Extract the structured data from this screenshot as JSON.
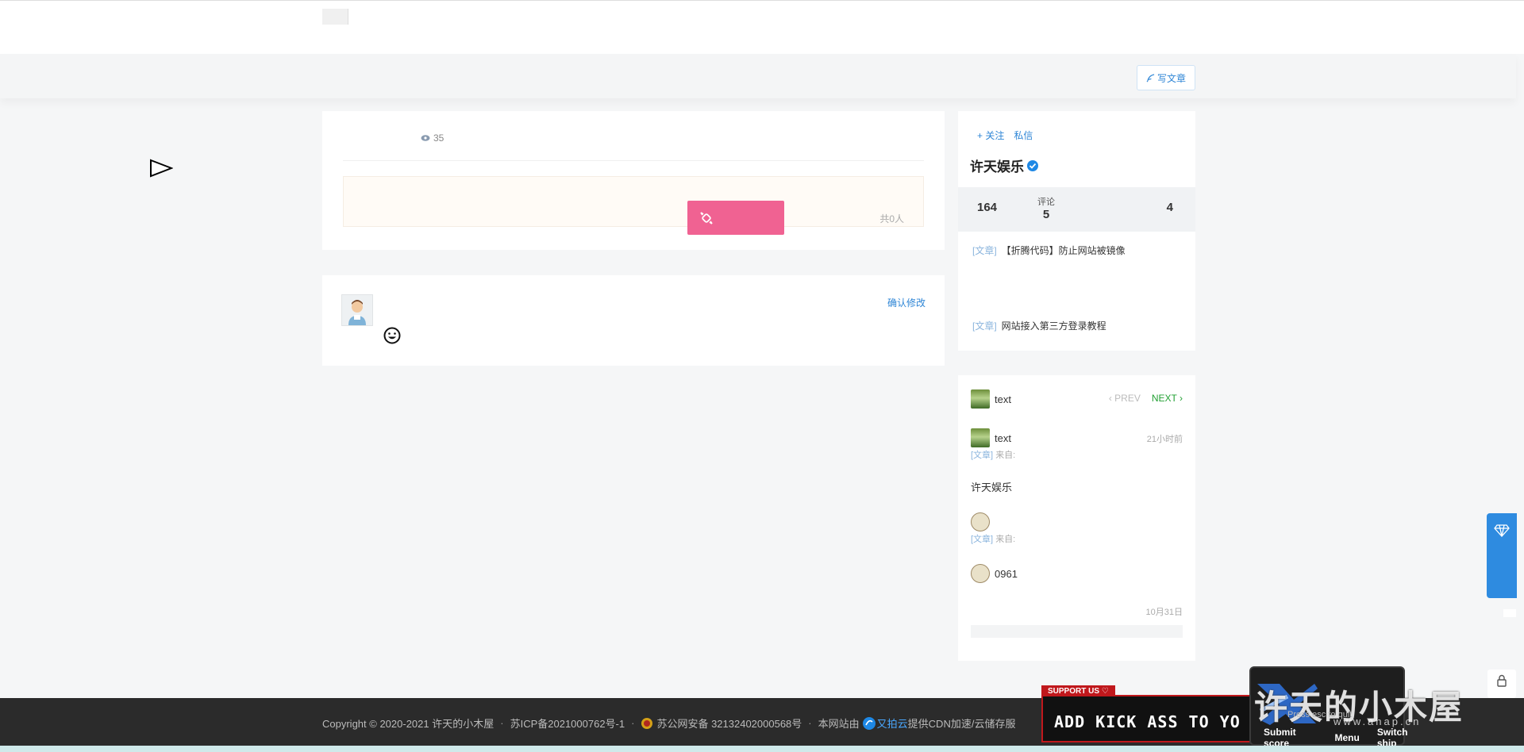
{
  "header": {
    "write_label": "写文章"
  },
  "post": {
    "views": "35",
    "reward_count": "共0人"
  },
  "comment": {
    "confirm_label": "确认修改"
  },
  "profile": {
    "follow_label": "+ 关注",
    "message_label": "私信",
    "name": "许天娱乐",
    "stat_a": "164",
    "stat_b_label": "评论",
    "stat_b_value": "5",
    "stat_c": "4",
    "articles": [
      {
        "tag": "[文章]",
        "title": "【折腾代码】防止网站被镜像"
      },
      {
        "tag": "[文章]",
        "title": "网站接入第三方登录教程"
      }
    ]
  },
  "feed": {
    "prev_label": "PREV",
    "next_label": "NEXT",
    "row1_user": "text",
    "row2_user": "text",
    "row2_time": "21小时前",
    "row2_meta_tag": "[文章]",
    "row2_meta_text": "来自:",
    "row3_text": "许天娱乐",
    "row4_meta_tag": "[文章]",
    "row4_meta_text": "来自:",
    "row5_user": "0961",
    "row5_time": "10月31日"
  },
  "footer": {
    "copyright": "Copyright © 2020-2021 许天的小木屋",
    "icp": "苏ICP备2021000762号-1",
    "police": "苏公网安备 32132402000568号",
    "cdn_prefix": "本网站由",
    "cdn_brand": "又拍云",
    "cdn_suffix": "提供CDN加速/云储存服"
  },
  "game": {
    "support_label": "SUPPORT US ♡",
    "title": "ADD KICK ASS TO YO",
    "esc_hint": "Press esc to quit",
    "menu": [
      "Submit score",
      "Menu",
      "Switch ship"
    ]
  },
  "watermark": {
    "text": "许天的小木屋",
    "url": "www.ahap.cn"
  },
  "colors": {
    "accent": "#2f86d6",
    "candy": "#f06292",
    "next": "#22a033",
    "side_tab": "#2e8be0"
  }
}
